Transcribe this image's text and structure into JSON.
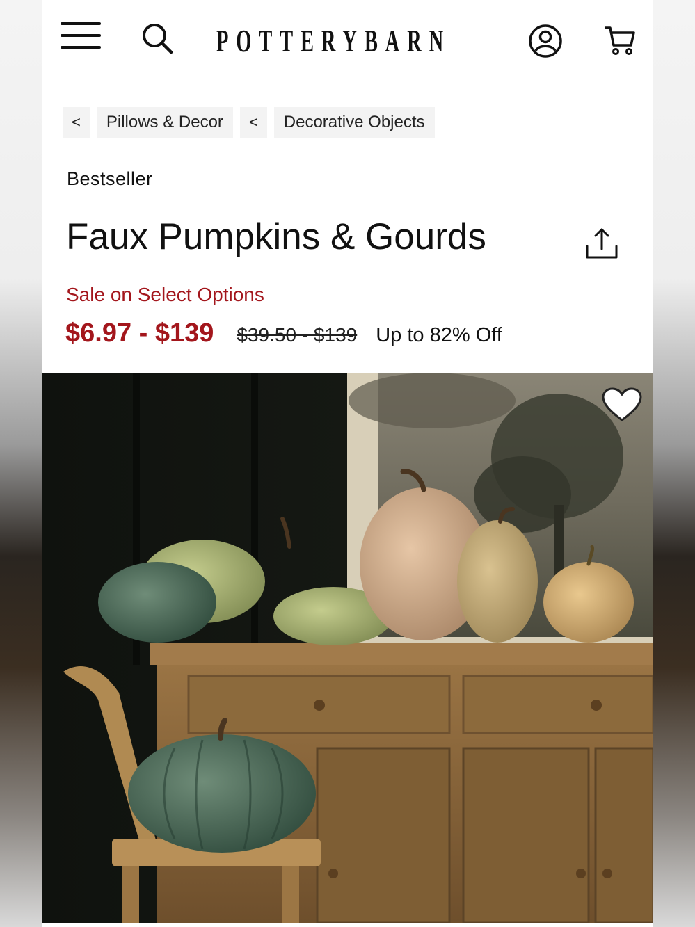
{
  "header": {
    "brand": "POTTERYBARN",
    "icons": {
      "menu": "hamburger-menu-icon",
      "search": "search-icon",
      "account": "account-icon",
      "cart": "cart-icon"
    }
  },
  "breadcrumbs": [
    {
      "back": "<",
      "label": "Pillows & Decor"
    },
    {
      "back": "<",
      "label": "Decorative Objects"
    }
  ],
  "product": {
    "badge": "Bestseller",
    "title": "Faux Pumpkins & Gourds",
    "sale_label": "Sale on Select Options",
    "price_range": "$6.97 - $139",
    "original_price_range": "$39.50 - $139",
    "discount_text": "Up to 82% Off",
    "image_alt": "faux pumpkins on wooden sideboard"
  },
  "colors": {
    "sale_red": "#a3161c",
    "text": "#111111",
    "crumb_bg": "#f3f3f3"
  }
}
